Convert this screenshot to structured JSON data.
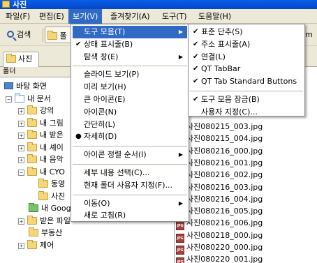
{
  "window": {
    "title": "사진"
  },
  "menubar": [
    {
      "label": "파일(F)"
    },
    {
      "label": "편집(E)"
    },
    {
      "label": "보기(V)"
    },
    {
      "label": "즐겨찾기(A)"
    },
    {
      "label": "도구(T)"
    },
    {
      "label": "도움말(H)"
    }
  ],
  "toolbar": {
    "search_label": "검색",
    "folder_label": "폴",
    "right_tag": "m"
  },
  "tab": {
    "label": "사진"
  },
  "folders_pane": {
    "header": "폴더",
    "tree": [
      {
        "label": "바탕 화면",
        "level": 0,
        "expander": "",
        "icon": "desktop"
      },
      {
        "label": "내 문서",
        "level": 1,
        "expander": "−",
        "icon": "docs"
      },
      {
        "label": "강의",
        "level": 2,
        "expander": "+",
        "icon": "folder"
      },
      {
        "label": "내 그림",
        "level": 2,
        "expander": "+",
        "icon": "folder"
      },
      {
        "label": "내 받은",
        "level": 2,
        "expander": "+",
        "icon": "folder"
      },
      {
        "label": "내 셰이",
        "level": 2,
        "expander": "+",
        "icon": "folder"
      },
      {
        "label": "내 음악",
        "level": 2,
        "expander": "+",
        "icon": "folder"
      },
      {
        "label": "내 CYO",
        "level": 2,
        "expander": "−",
        "icon": "folder"
      },
      {
        "label": "동영",
        "level": 3,
        "expander": "",
        "icon": "folder"
      },
      {
        "label": "사진",
        "level": 3,
        "expander": "",
        "icon": "folder"
      },
      {
        "label": "내 Google 가제트",
        "level": 2,
        "expander": "",
        "icon": "gadget"
      },
      {
        "label": "받은 파일",
        "level": 2,
        "expander": "+",
        "icon": "folder"
      },
      {
        "label": "부동산",
        "level": 2,
        "expander": "",
        "icon": "folder"
      },
      {
        "label": "제어",
        "level": 2,
        "expander": "+",
        "icon": "folder"
      }
    ]
  },
  "files": [
    "사진080215_003.jpg",
    "사진080215_004.jpg",
    "사진080216_000.jpg",
    "사진080216_001.jpg",
    "사진080216_002.jpg",
    "사진080216_003.jpg",
    "사진080216_004.jpg",
    "사진080216_005.jpg",
    "사진080216_006.jpg",
    "사진080218_000.jpg",
    "사진080220_000.jpg",
    "사진080220_001.jpg"
  ],
  "file_icon_text": "JPG",
  "view_menu": {
    "items": [
      {
        "type": "item",
        "label": "도구 모음(T)",
        "mark": "",
        "submenu": true,
        "highlighted": true
      },
      {
        "type": "item",
        "label": "상태 표시줄(B)",
        "mark": "check",
        "submenu": false
      },
      {
        "type": "item",
        "label": "탐색 창(E)",
        "mark": "",
        "submenu": true
      },
      {
        "type": "sep"
      },
      {
        "type": "item",
        "label": "슬라이드 보기(P)",
        "mark": "",
        "submenu": false
      },
      {
        "type": "item",
        "label": "미리 보기(H)",
        "mark": "",
        "submenu": false
      },
      {
        "type": "item",
        "label": "큰 아이콘(E)",
        "mark": "",
        "submenu": false
      },
      {
        "type": "item",
        "label": "아이콘(N)",
        "mark": "",
        "submenu": false
      },
      {
        "type": "item",
        "label": "간단히(L)",
        "mark": "",
        "submenu": false
      },
      {
        "type": "item",
        "label": "자세히(D)",
        "mark": "bullet",
        "submenu": false
      },
      {
        "type": "sep"
      },
      {
        "type": "item",
        "label": "아이콘 정렬 순서(I)",
        "mark": "",
        "submenu": true
      },
      {
        "type": "sep"
      },
      {
        "type": "item",
        "label": "세부 내용 선택(C)...",
        "mark": "",
        "submenu": false
      },
      {
        "type": "item",
        "label": "현재 폴더 사용자 지정(F)...",
        "mark": "",
        "submenu": false
      },
      {
        "type": "sep"
      },
      {
        "type": "item",
        "label": "이동(O)",
        "mark": "",
        "submenu": true
      },
      {
        "type": "item",
        "label": "새로 고침(R)",
        "mark": "",
        "submenu": false
      }
    ]
  },
  "toolbars_submenu": {
    "items": [
      {
        "type": "item",
        "label": "표준 단추(S)",
        "mark": "check"
      },
      {
        "type": "item",
        "label": "주소 표시줄(A)",
        "mark": "check"
      },
      {
        "type": "item",
        "label": "연결(L)",
        "mark": "check"
      },
      {
        "type": "item",
        "label": "QT TabBar",
        "mark": "check"
      },
      {
        "type": "item",
        "label": "QT Tab Standard Buttons",
        "mark": "check"
      },
      {
        "type": "sep"
      },
      {
        "type": "item",
        "label": "도구 모음 잠금(B)",
        "mark": "check"
      },
      {
        "type": "item",
        "label": "사용자 지정(C)...",
        "mark": ""
      }
    ]
  },
  "glyphs": {
    "check": "✔",
    "bullet": "●",
    "arrow": "▶"
  }
}
